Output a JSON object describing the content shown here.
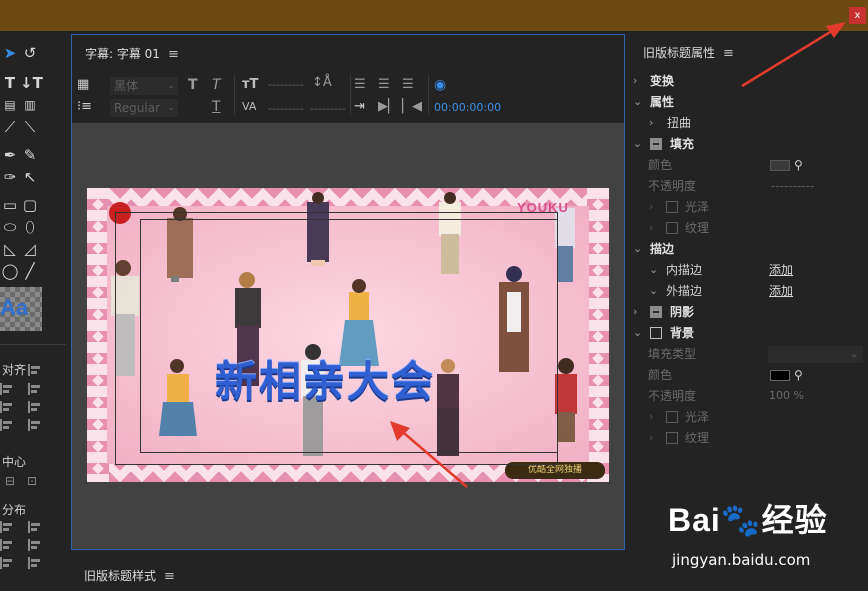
{
  "window": {
    "close_label": "x"
  },
  "tools": {
    "aa_label": "Aa",
    "align_label": "对齐",
    "center_label": "中心",
    "distribute_label": "分布"
  },
  "editor": {
    "title": "字幕: 字幕 01",
    "font_family": "黑体",
    "font_style": "Regular",
    "timecode": "00:00:00:00"
  },
  "video": {
    "title_text": "新相亲大会",
    "logo_text": "YOUKU",
    "badge_text": "优酷全网独播"
  },
  "styles_panel": {
    "title": "旧版标题样式"
  },
  "properties": {
    "title": "旧版标题属性",
    "transform": "变换",
    "attributes": "属性",
    "distort": "扭曲",
    "fill": "填充",
    "color": "颜色",
    "opacity": "不透明度",
    "sheen": "光泽",
    "texture": "纹理",
    "strokes": "描边",
    "inner_stroke": "内描边",
    "outer_stroke": "外描边",
    "add": "添加",
    "shadow": "阴影",
    "background": "背景",
    "fill_type": "填充类型",
    "bg_color": "颜色",
    "bg_opacity": "不透明度",
    "bg_opacity_value": "100 %",
    "bg_sheen": "光泽",
    "bg_texture": "纹理",
    "fill_color_hex": "#3a3a3a",
    "bg_color_hex": "#000000"
  },
  "watermark": {
    "main": "Bai🐾经验",
    "sub": "jingyan.baidu.com"
  },
  "colors": {
    "accent_blue": "#2e63b0",
    "arrow_red": "#e23b2e",
    "title_bar": "#6d4a12"
  }
}
